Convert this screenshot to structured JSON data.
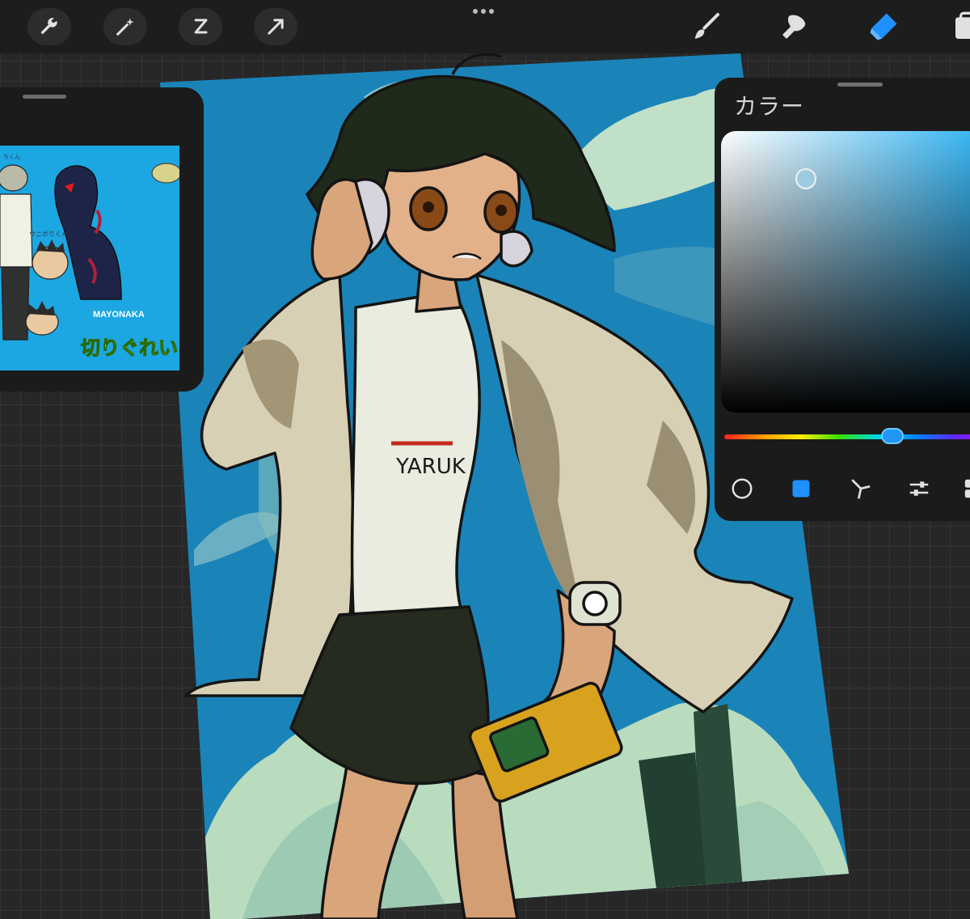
{
  "toolbar": {
    "left_buttons": [
      {
        "icon": "wrench-icon",
        "label": "actions"
      },
      {
        "icon": "magic-wand-icon",
        "label": "adjustments"
      },
      {
        "icon": "selection-icon",
        "label": "selection"
      },
      {
        "icon": "arrow-cursor-icon",
        "label": "transform"
      }
    ],
    "tools": [
      {
        "icon": "brush-icon",
        "active": false
      },
      {
        "icon": "smudge-icon",
        "active": false
      },
      {
        "icon": "eraser-icon",
        "active": true
      },
      {
        "icon": "layers-icon",
        "active": false
      }
    ],
    "active_color": "#1e90ff",
    "icon_color": "#e0e0e0"
  },
  "artwork": {
    "shirt_text": "YARUK"
  },
  "reference_panel": {
    "art_texts": [
      "MAYONAKA",
      "ウニボりくん",
      "ちくん",
      "切りぐれい"
    ],
    "art_background": "#1ca7e2"
  },
  "color_panel": {
    "title": "カラー",
    "current_color": "#9ccbe0",
    "modes": [
      {
        "icon": "disc-mode-icon",
        "active": false
      },
      {
        "icon": "classic-mode-icon",
        "active": true
      },
      {
        "icon": "harmony-mode-icon",
        "active": false
      },
      {
        "icon": "value-mode-icon",
        "active": false
      },
      {
        "icon": "palettes-mode-icon",
        "active": false
      }
    ]
  }
}
